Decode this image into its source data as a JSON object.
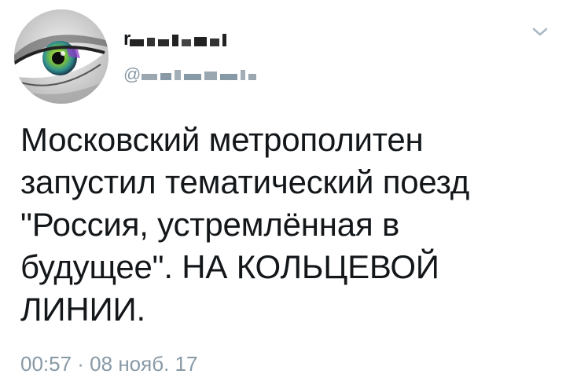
{
  "tweet": {
    "display_name": "r",
    "handle": "@",
    "text": "Московский метрополитен\nзапустил тематический поезд\n\"Россия, устремлённая в\nбудущее\". НА КОЛЬЦЕВОЙ\nЛИНИИ.",
    "timestamp": "00:57 · 08 нояб. 17"
  },
  "icons": {
    "avatar": "eye-avatar",
    "menu": "chevron-down-icon"
  },
  "colors": {
    "text": "#14171a",
    "secondary": "#8899a6",
    "background": "#ffffff"
  }
}
